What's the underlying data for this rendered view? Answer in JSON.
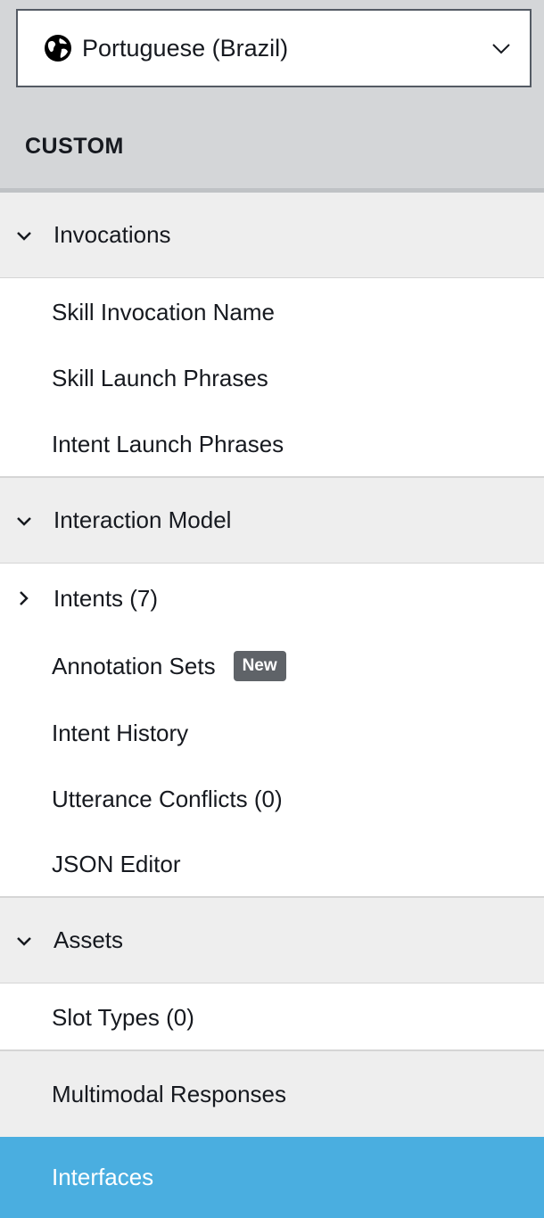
{
  "locale": {
    "label": "Portuguese (Brazil)",
    "icon": "globe-icon",
    "dropdown_icon": "chevron-down-icon"
  },
  "heading": "CUSTOM",
  "sections": {
    "invocations": {
      "label": "Invocations",
      "items": [
        "Skill Invocation Name",
        "Skill Launch Phrases",
        "Intent Launch Phrases"
      ]
    },
    "interaction_model": {
      "label": "Interaction Model",
      "intents_label": "Intents (7)",
      "annotation_sets": "Annotation Sets",
      "new_badge": "New",
      "intent_history": "Intent History",
      "utterance_conflicts": "Utterance Conflicts (0)",
      "json_editor": "JSON Editor"
    },
    "assets": {
      "label": "Assets",
      "slot_types": "Slot Types (0)"
    }
  },
  "multimodal_responses": "Multimodal Responses",
  "interfaces": "Interfaces",
  "colors": {
    "active": "#4aaee0",
    "section_bg": "#eeeeee",
    "header_bg": "#d4d6d8",
    "badge": "#5f6368"
  }
}
